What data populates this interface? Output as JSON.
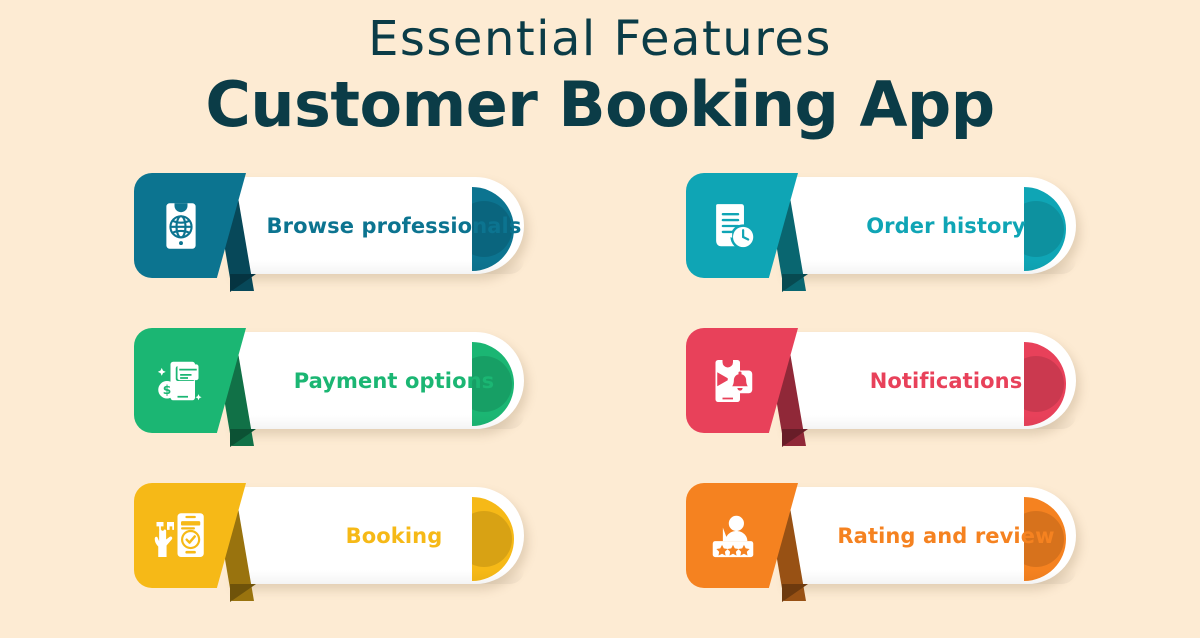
{
  "header": {
    "subtitle": "Essential Features",
    "title": "Customer Booking App"
  },
  "theme": {
    "background": "#FDEBD3",
    "title_color": "#0B3C47",
    "card_white": "#FFFFFF"
  },
  "cards": [
    {
      "id": "browse-professionals",
      "label": "Browse professionals",
      "color": "#0C7490",
      "icon": "phone-globe-icon",
      "row": 1,
      "column": "left"
    },
    {
      "id": "order-history",
      "label": "Order history",
      "color": "#0FA5B5",
      "icon": "document-clock-icon",
      "row": 1,
      "column": "right"
    },
    {
      "id": "payment-options",
      "label": "Payment options",
      "color": "#1BB673",
      "icon": "phone-card-dollar-icon",
      "row": 2,
      "column": "left"
    },
    {
      "id": "notifications",
      "label": "Notifications",
      "color": "#E8415A",
      "icon": "phone-bell-icon",
      "row": 2,
      "column": "right"
    },
    {
      "id": "booking",
      "label": "Booking",
      "color": "#F6B917",
      "icon": "hand-phone-check-icon",
      "row": 3,
      "column": "left"
    },
    {
      "id": "rating-and-review",
      "label": "Rating and review",
      "color": "#F58220",
      "icon": "person-stars-icon",
      "row": 3,
      "column": "right"
    }
  ]
}
